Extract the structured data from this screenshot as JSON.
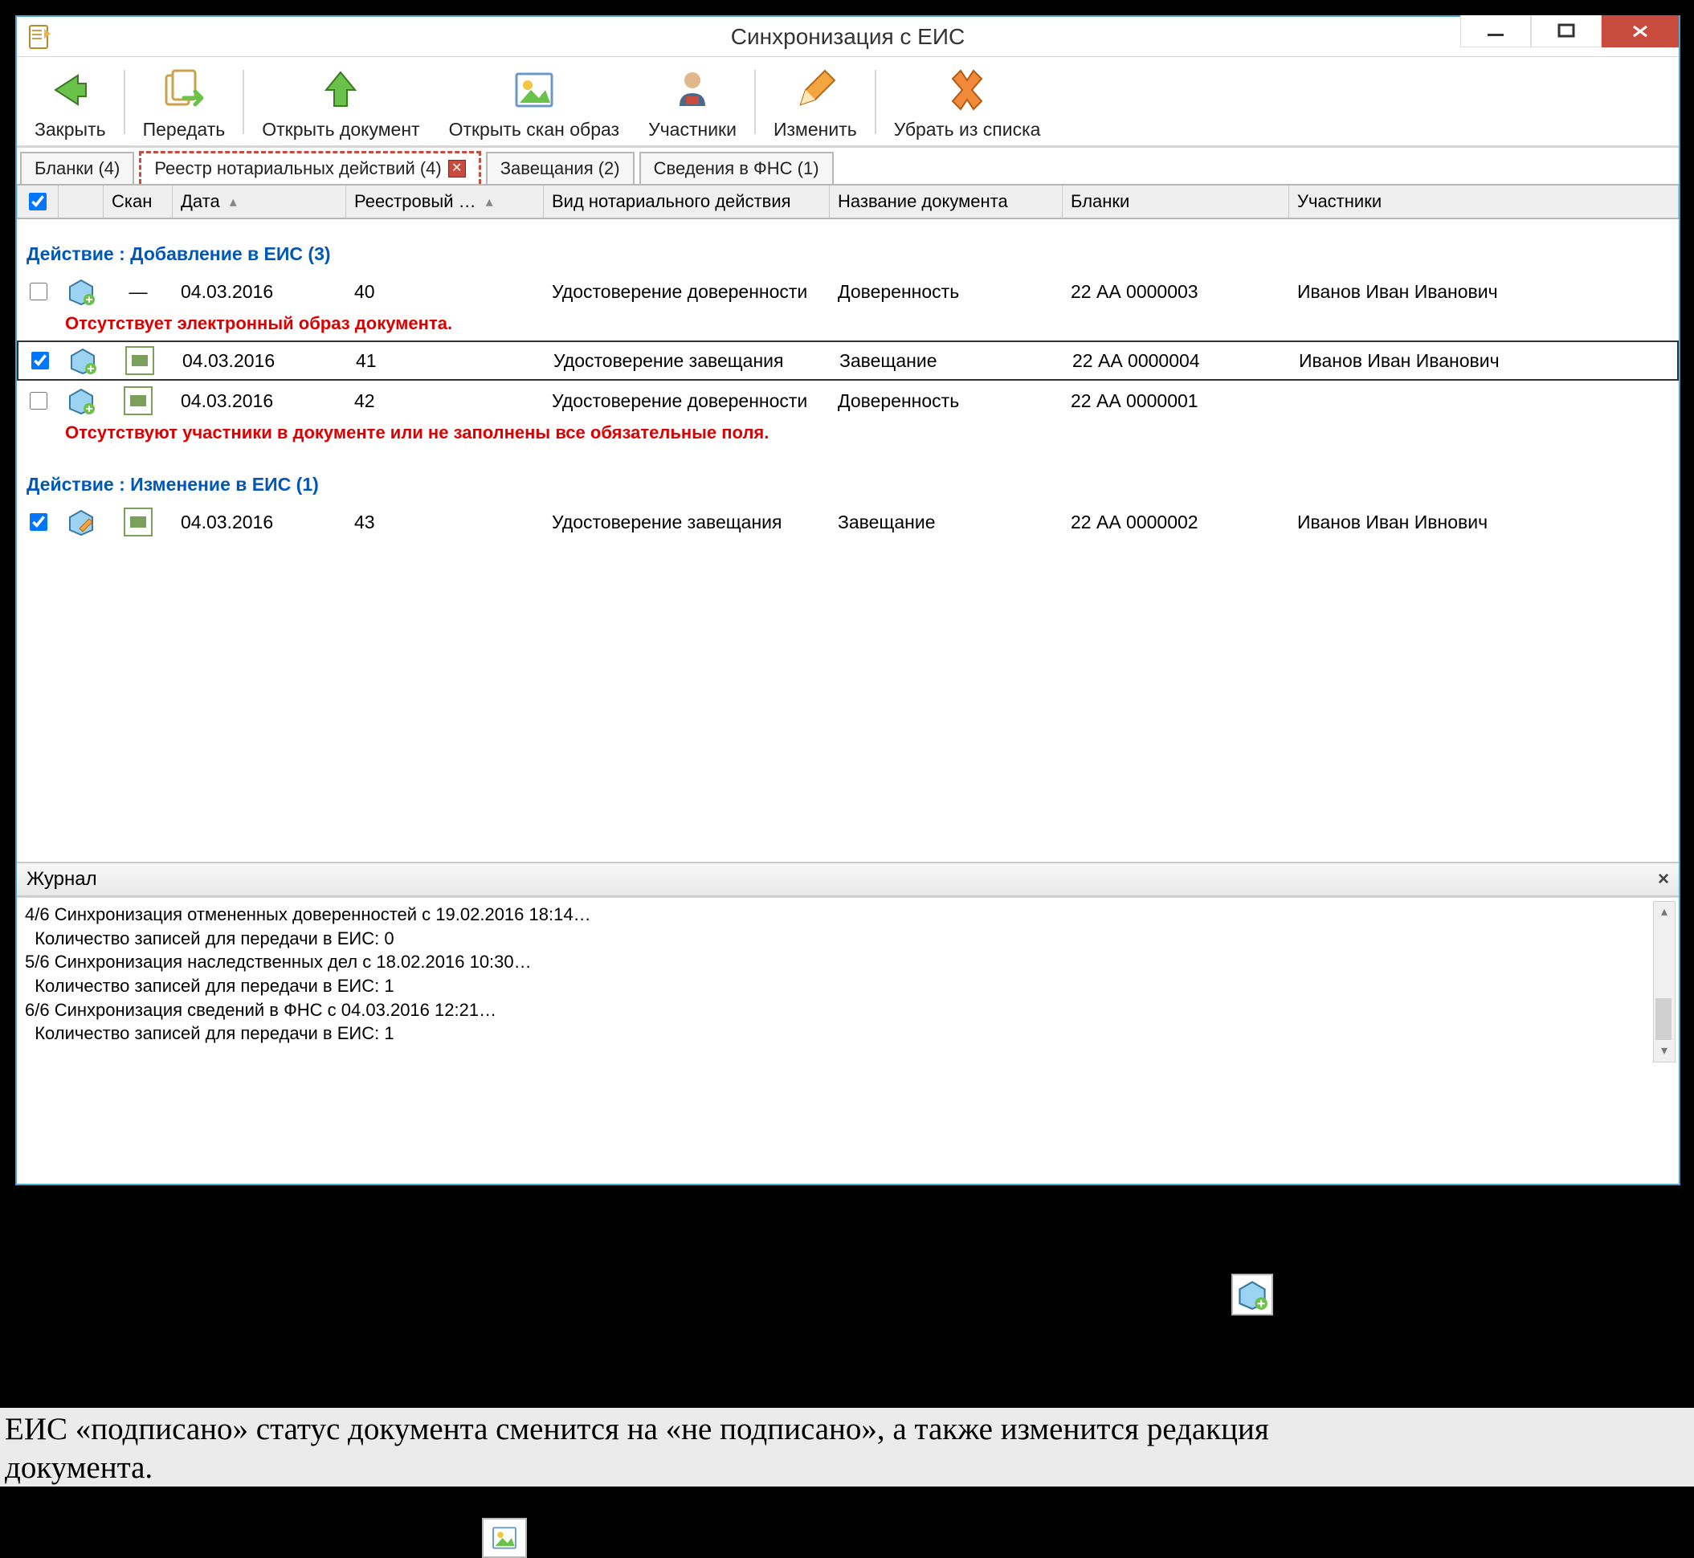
{
  "window": {
    "title": "Синхронизация с ЕИС"
  },
  "toolbar": {
    "close": "Закрыть",
    "send": "Передать",
    "open_doc": "Открыть документ",
    "open_scan": "Открыть скан образ",
    "participants": "Участники",
    "edit": "Изменить",
    "remove": "Убрать из списка"
  },
  "tabs": {
    "blanks": "Бланки (4)",
    "registry": "Реестр нотариальных действий (4)",
    "wills": "Завещания (2)",
    "fns": "Сведения в ФНС (1)"
  },
  "columns": {
    "scan": "Скан",
    "date": "Дата",
    "reg": "Реестровый …",
    "type": "Вид нотариального действия",
    "name": "Название документа",
    "blanks": "Бланки",
    "participants": "Участники"
  },
  "groups": {
    "add": "Действие : Добавление в ЕИС (3)",
    "edit": "Действие : Изменение в ЕИС (1)"
  },
  "rows_add": [
    {
      "checked": false,
      "scan": "—",
      "date": "04.03.2016",
      "reg": "40",
      "type": "Удостоверение доверенности",
      "name": "Доверенность",
      "blank": "22 АА 0000003",
      "participant": "Иванов Иван Иванович",
      "selected": false
    },
    {
      "checked": true,
      "scan": "icon",
      "date": "04.03.2016",
      "reg": "41",
      "type": "Удостоверение завещания",
      "name": "Завещание",
      "blank": "22 АА 0000004",
      "participant": "Иванов Иван Иванович",
      "selected": true
    },
    {
      "checked": false,
      "scan": "icon",
      "date": "04.03.2016",
      "reg": "42",
      "type": "Удостоверение доверенности",
      "name": "Доверенность",
      "blank": "22 АА 0000001",
      "participant": "",
      "selected": false
    }
  ],
  "errors": {
    "no_scan": "Отсутствует электронный образ документа.",
    "no_participants": "Отсутствуют участники в документе или не заполнены все обязательные поля."
  },
  "rows_edit": [
    {
      "checked": true,
      "scan": "icon",
      "date": "04.03.2016",
      "reg": "43",
      "type": "Удостоверение завещания",
      "name": "Завещание",
      "blank": "22 АА 0000002",
      "participant": "Иванов Иван Ивнович",
      "selected": false
    }
  ],
  "log": {
    "title": "Журнал",
    "lines": [
      "4/6 Синхронизация отмененных доверенностей с 19.02.2016 18:14…",
      "  Количество записей для передачи в ЕИС: 0",
      "5/6 Синхронизация наследственных дел с 18.02.2016 10:30…",
      "  Количество записей для передачи в ЕИС: 1",
      "6/6 Синхронизация сведений в ФНС с 04.03.2016 12:21…",
      "  Количество записей для передачи в ЕИС: 1"
    ]
  },
  "body_text": {
    "line1": "ЕИС «подписано» статус документа сменится на «не подписано», а также изменится редакция",
    "line2": "документа."
  }
}
